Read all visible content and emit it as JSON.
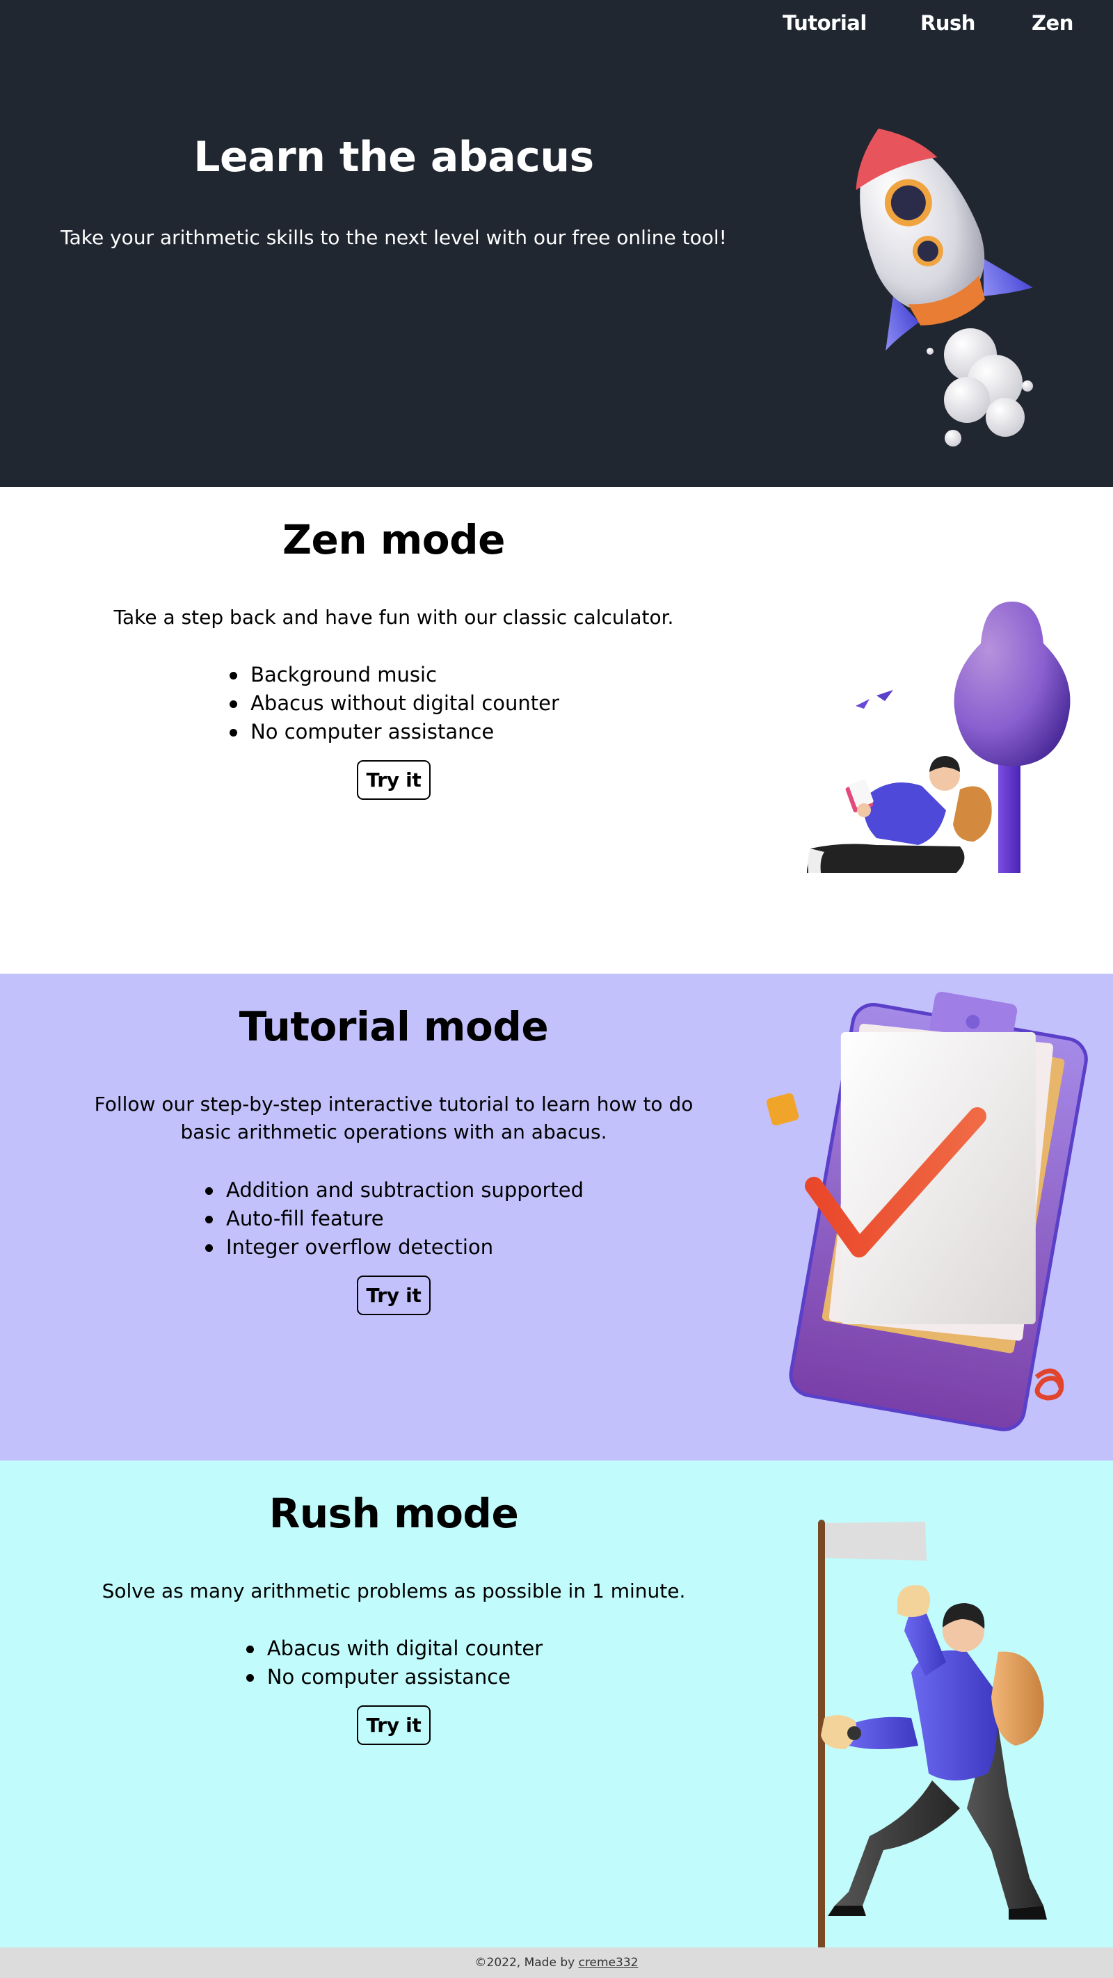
{
  "nav": {
    "items": [
      {
        "label": "Tutorial"
      },
      {
        "label": "Rush"
      },
      {
        "label": "Zen"
      }
    ]
  },
  "hero": {
    "title": "Learn the abacus",
    "subtitle": "Take your arithmetic skills to the next level with our free online tool!",
    "illustration": "rocket-illustration"
  },
  "zen": {
    "title": "Zen mode",
    "description": "Take a step back and have fun with our classic calculator.",
    "features": [
      "Background music",
      "Abacus without digital counter",
      "No computer assistance"
    ],
    "button": "Try it",
    "illustration": "person-reading-under-tree-illustration"
  },
  "tutorial": {
    "title": "Tutorial mode",
    "description": "Follow our step-by-step interactive tutorial to learn how to do basic arithmetic operations with an abacus.",
    "features": [
      "Addition and subtraction supported",
      "Auto-fill feature",
      "Integer overflow detection"
    ],
    "button": "Try it",
    "illustration": "clipboard-checkmark-illustration"
  },
  "rush": {
    "title": "Rush mode",
    "description": "Solve as many arithmetic problems as possible in 1 minute.",
    "features": [
      "Abacus with digital counter",
      "No computer assistance"
    ],
    "button": "Try it",
    "illustration": "hiker-with-flag-illustration"
  },
  "footer": {
    "text": "©2022, Made by ",
    "link": "creme332"
  },
  "colors": {
    "dark": "#212731",
    "tutorial_bg": "#c3c1fb",
    "rush_bg": "#c1fbfb",
    "footer_bg": "#dcdcdc"
  }
}
